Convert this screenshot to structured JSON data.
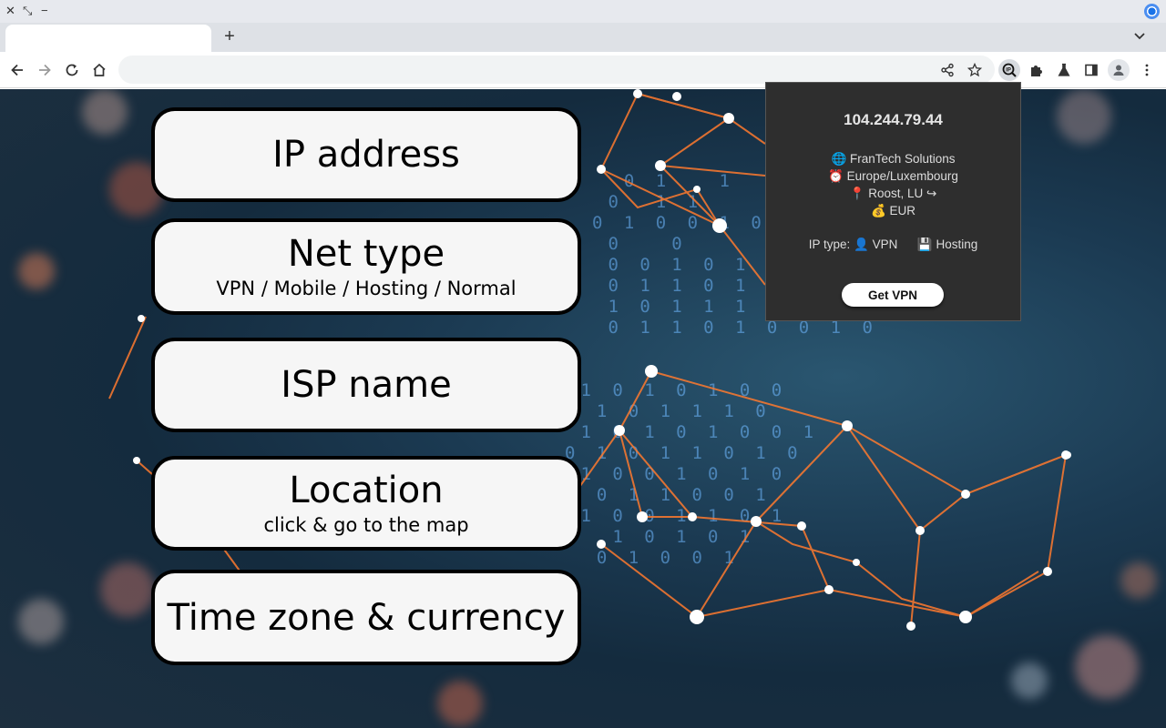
{
  "browser": {
    "window_controls": {
      "close": "✕",
      "restore": "⤡",
      "minimize": "−"
    },
    "tab": {
      "title": ""
    },
    "new_tab_label": "+",
    "omnibox": {
      "url": ""
    }
  },
  "cards": [
    {
      "title": "IP address",
      "subtitle": ""
    },
    {
      "title": "Net type",
      "subtitle": "VPN / Mobile / Hosting / Normal"
    },
    {
      "title": "ISP name",
      "subtitle": ""
    },
    {
      "title": "Location",
      "subtitle": "click & go to the map"
    },
    {
      "title": "Time zone & currency",
      "subtitle": ""
    }
  ],
  "popup": {
    "ip": "104.244.79.44",
    "isp": "🌐 FranTech Solutions",
    "timezone": "⏰ Europe/Luxembourg",
    "location": "📍 Roost, LU ↪",
    "currency": "💰 EUR",
    "ip_type_label": "IP type:",
    "ip_type_vpn": "👤 VPN",
    "ip_type_hosting": "💾 Hosting",
    "button_label": "Get VPN"
  },
  "icons": {
    "back": "back-arrow-icon",
    "forward": "forward-arrow-icon",
    "reload": "reload-icon",
    "home": "home-icon",
    "share": "share-icon",
    "bookmark": "star-icon",
    "extension_active": "ip-lookup-icon",
    "extensions": "puzzle-icon",
    "labs": "flask-icon",
    "side_panel": "side-panel-icon",
    "profile": "profile-icon",
    "menu": "kebab-menu-icon"
  },
  "colors": {
    "popup_bg": "#2e2e2e",
    "card_bg": "#f6f6f6",
    "network_lines": "#ff7a2e",
    "binary_text": "#6fb8ff"
  }
}
